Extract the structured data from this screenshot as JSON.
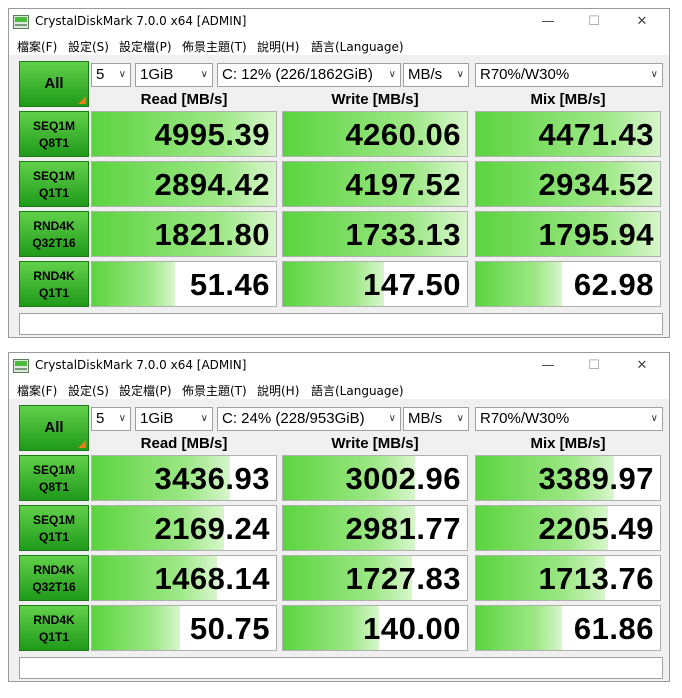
{
  "windows": [
    {
      "title": "CrystalDiskMark 7.0.0 x64 [ADMIN]",
      "controls": {
        "minimize": "—",
        "maximize": "☐",
        "close": "✕"
      },
      "menu": [
        "檔案(F)",
        "設定(S)",
        "設定檔(P)",
        "佈景主題(T)",
        "說明(H)",
        "語言(Language)"
      ],
      "all_label": "All",
      "count": "5",
      "size": "1GiB",
      "drive": "C: 12% (226/1862GiB)",
      "unit": "MB/s",
      "mix_ratio": "R70%/W30%",
      "headers": {
        "read": "Read [MB/s]",
        "write": "Write [MB/s]",
        "mix": "Mix [MB/s]"
      },
      "rows": [
        {
          "l1": "SEQ1M",
          "l2": "Q8T1",
          "read": "4995.39",
          "write": "4260.06",
          "mix": "4471.43"
        },
        {
          "l1": "SEQ1M",
          "l2": "Q1T1",
          "read": "2894.42",
          "write": "4197.52",
          "mix": "2934.52"
        },
        {
          "l1": "RND4K",
          "l2": "Q32T16",
          "read": "1821.80",
          "write": "1733.13",
          "mix": "1795.94"
        },
        {
          "l1": "RND4K",
          "l2": "Q1T1",
          "read": "51.46",
          "write": "147.50",
          "mix": "62.98"
        }
      ],
      "bar_fraction": [
        {
          "read": 1.0,
          "write": 1.0,
          "mix": 1.0
        },
        {
          "read": 1.0,
          "write": 1.0,
          "mix": 1.0
        },
        {
          "read": 1.0,
          "write": 1.0,
          "mix": 1.0
        },
        {
          "read": 0.45,
          "write": 0.55,
          "mix": 0.47
        }
      ],
      "comment": ""
    },
    {
      "title": "CrystalDiskMark 7.0.0 x64 [ADMIN]",
      "controls": {
        "minimize": "—",
        "maximize": "☐",
        "close": "✕"
      },
      "menu": [
        "檔案(F)",
        "設定(S)",
        "設定檔(P)",
        "佈景主題(T)",
        "說明(H)",
        "語言(Language)"
      ],
      "all_label": "All",
      "count": "5",
      "size": "1GiB",
      "drive": "C: 24% (228/953GiB)",
      "unit": "MB/s",
      "mix_ratio": "R70%/W30%",
      "headers": {
        "read": "Read [MB/s]",
        "write": "Write [MB/s]",
        "mix": "Mix [MB/s]"
      },
      "rows": [
        {
          "l1": "SEQ1M",
          "l2": "Q8T1",
          "read": "3436.93",
          "write": "3002.96",
          "mix": "3389.97"
        },
        {
          "l1": "SEQ1M",
          "l2": "Q1T1",
          "read": "2169.24",
          "write": "2981.77",
          "mix": "2205.49"
        },
        {
          "l1": "RND4K",
          "l2": "Q32T16",
          "read": "1468.14",
          "write": "1727.83",
          "mix": "1713.76"
        },
        {
          "l1": "RND4K",
          "l2": "Q1T1",
          "read": "50.75",
          "write": "140.00",
          "mix": "61.86"
        }
      ],
      "bar_fraction": [
        {
          "read": 0.75,
          "write": 0.72,
          "mix": 0.75
        },
        {
          "read": 0.72,
          "write": 0.72,
          "mix": 0.72
        },
        {
          "read": 0.68,
          "write": 0.7,
          "mix": 0.7
        },
        {
          "read": 0.48,
          "write": 0.52,
          "mix": 0.47
        }
      ],
      "comment": ""
    }
  ],
  "colors": {
    "button_green": "#3cb82e",
    "bar_green": "#5bd43f",
    "corner_orange": "#e87a1a"
  }
}
